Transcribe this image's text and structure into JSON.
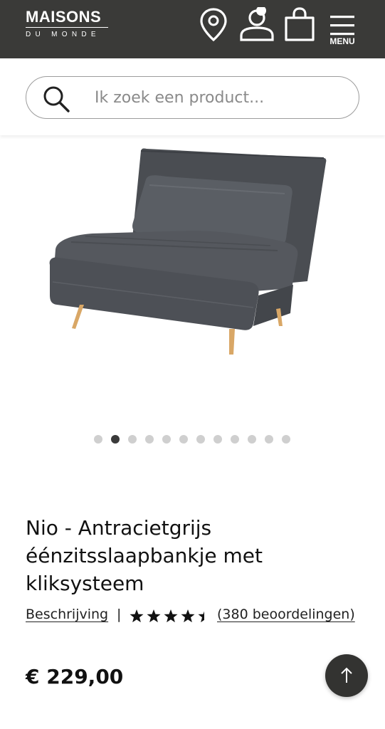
{
  "header": {
    "logo_main": "MAISONS",
    "logo_sub": "DU MONDE",
    "menu_label": "MENU",
    "icons": [
      "location-pin-icon",
      "account-icon",
      "shopping-bag-icon",
      "menu-icon"
    ],
    "background_color": "#3a3a38"
  },
  "search": {
    "placeholder": "Ik zoek een product..."
  },
  "gallery": {
    "total_images": 12,
    "active_index": 1
  },
  "product": {
    "title": "Nio - Antracietgrijs éénzitsslaapbankje met kliksysteem",
    "description_link": "Beschrijving",
    "separator": "|",
    "rating": 4.5,
    "reviews_label": "(380 beoordelingen)",
    "price": "€ 229,00"
  },
  "scroll_top": {
    "icon": "arrow-up-icon"
  }
}
